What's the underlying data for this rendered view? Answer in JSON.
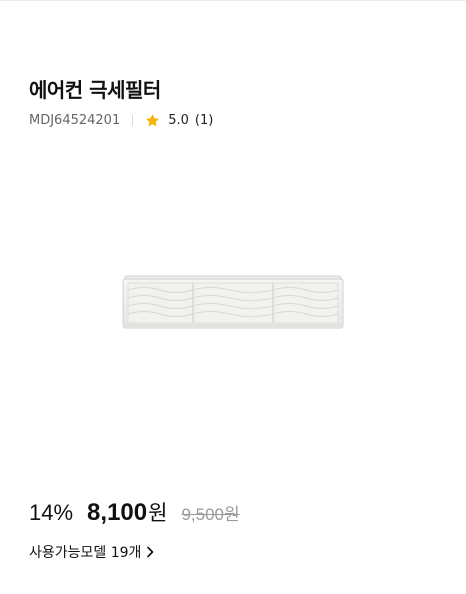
{
  "product": {
    "title": "에어컨 극세필터",
    "sku": "MDJ64524201",
    "rating": "5.0",
    "review_count": "(1)",
    "image_icon": "air-filter-image"
  },
  "pricing": {
    "discount": "14%",
    "price": "8,100",
    "price_unit": "원",
    "original_price": "9,500원"
  },
  "models": {
    "label": "사용가능모델 19개"
  },
  "colors": {
    "star": "#f5b400",
    "text": "#111111",
    "muted": "#9a9a9a"
  }
}
